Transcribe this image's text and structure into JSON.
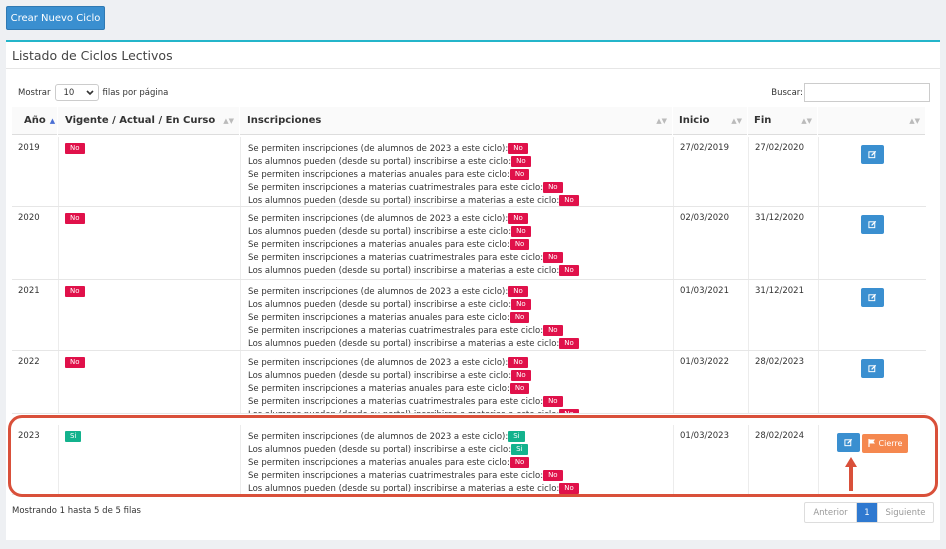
{
  "top": {
    "create_button": "Crear Nuevo Ciclo"
  },
  "panel": {
    "title": "Listado de Ciclos Lectivos"
  },
  "controls": {
    "length_prefix": "Mostrar",
    "length_value": "10",
    "length_suffix": "filas por página",
    "search_label": "Buscar:"
  },
  "table": {
    "headers": [
      "Año",
      "Vigente / Actual / En Curso",
      "Inscripciones",
      "Inicio",
      "Fin",
      ""
    ],
    "inscripcion_labels": [
      "Se permiten inscripciones (de alumnos de 2023 a este ciclo):",
      "Los alumnos pueden (desde su portal) inscribirse a este ciclo:",
      "Se permiten inscripciones a materias anuales para este ciclo:",
      "Se permiten inscripciones a materias cuatrimestrales para este ciclo:",
      "Los alumnos pueden (desde su portal) inscribirse a materias a este ciclo:"
    ],
    "rows": [
      {
        "year": "2019",
        "vigente": "No",
        "flags": [
          "No",
          "No",
          "No",
          "No",
          "No"
        ],
        "inicio": "27/02/2019",
        "fin": "27/02/2020"
      },
      {
        "year": "2020",
        "vigente": "No",
        "flags": [
          "No",
          "No",
          "No",
          "No",
          "No"
        ],
        "inicio": "02/03/2020",
        "fin": "31/12/2020"
      },
      {
        "year": "2021",
        "vigente": "No",
        "flags": [
          "No",
          "No",
          "No",
          "No",
          "No"
        ],
        "inicio": "01/03/2021",
        "fin": "31/12/2021"
      },
      {
        "year": "2022",
        "vigente": "No",
        "flags": [
          "No",
          "No",
          "No",
          "No",
          "No"
        ],
        "inicio": "01/03/2022",
        "fin": "28/02/2023"
      },
      {
        "year": "2023",
        "vigente": "Si",
        "flags": [
          "Si",
          "Si",
          "No",
          "No",
          "No"
        ],
        "inicio": "01/03/2023",
        "fin": "28/02/2024",
        "cierre": "Cierre"
      }
    ]
  },
  "footer": {
    "info": "Mostrando 1 hasta 5 de 5 filas",
    "prev": "Anterior",
    "page": "1",
    "next": "Siguiente"
  },
  "colors": {
    "primary": "#3a8fd0",
    "no_badge": "#e0114a",
    "si_badge": "#13b28d",
    "cierre": "#f5884f",
    "highlight": "#d9503a"
  }
}
